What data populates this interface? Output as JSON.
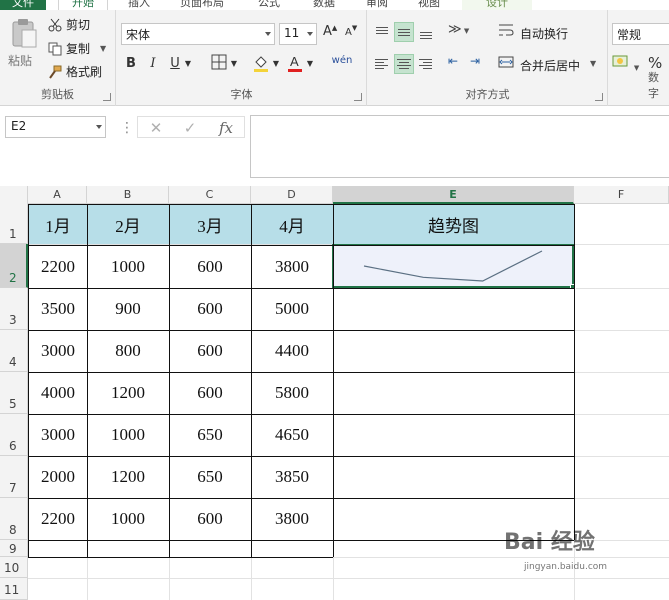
{
  "ribbon": {
    "tabs": [
      "文件",
      "开始",
      "插入",
      "页面布局",
      "公式",
      "数据",
      "审阅",
      "视图",
      "设计"
    ],
    "clipboard": {
      "paste_label": "粘贴",
      "cut_label": "剪切",
      "copy_label": "复制",
      "format_painter_label": "格式刷",
      "group_label": "剪贴板"
    },
    "font": {
      "font_name": "宋体",
      "font_size": "11",
      "bold": "B",
      "italic": "I",
      "underline": "U",
      "grow": "A",
      "shrink": "A",
      "phonetic": "wén",
      "group_label": "字体"
    },
    "alignment": {
      "wrap_text_label": "自动换行",
      "merge_center_label": "合并后居中",
      "group_label": "对齐方式"
    },
    "number": {
      "format_value": "常规",
      "percent": "%",
      "group_label": "数字"
    }
  },
  "formula_bar": {
    "name_box": "E2",
    "fx": "fx",
    "formula": ""
  },
  "sheet": {
    "columns": [
      "A",
      "B",
      "C",
      "D",
      "E",
      "F"
    ],
    "selected_column": "E",
    "rows": [
      "1",
      "2",
      "3",
      "4",
      "5",
      "6",
      "7",
      "8",
      "9",
      "10",
      "11"
    ],
    "selected_row": "2",
    "headers": [
      "1月",
      "2月",
      "3月",
      "4月",
      "趋势图"
    ],
    "data": [
      [
        "2200",
        "1000",
        "600",
        "3800"
      ],
      [
        "3500",
        "900",
        "600",
        "5000"
      ],
      [
        "3000",
        "800",
        "600",
        "4400"
      ],
      [
        "4000",
        "1200",
        "600",
        "5800"
      ],
      [
        "3000",
        "1000",
        "650",
        "4650"
      ],
      [
        "2000",
        "1200",
        "650",
        "3850"
      ],
      [
        "2200",
        "1000",
        "600",
        "3800"
      ]
    ],
    "sparkline_values": [
      2200,
      1000,
      600,
      3800
    ],
    "sparkline_color": "#5b7083",
    "header_fill": "#b7dee8",
    "selection_color": "#217346"
  },
  "watermark": {
    "brand": "Bai 经验",
    "url": "jingyan.baidu.com"
  }
}
